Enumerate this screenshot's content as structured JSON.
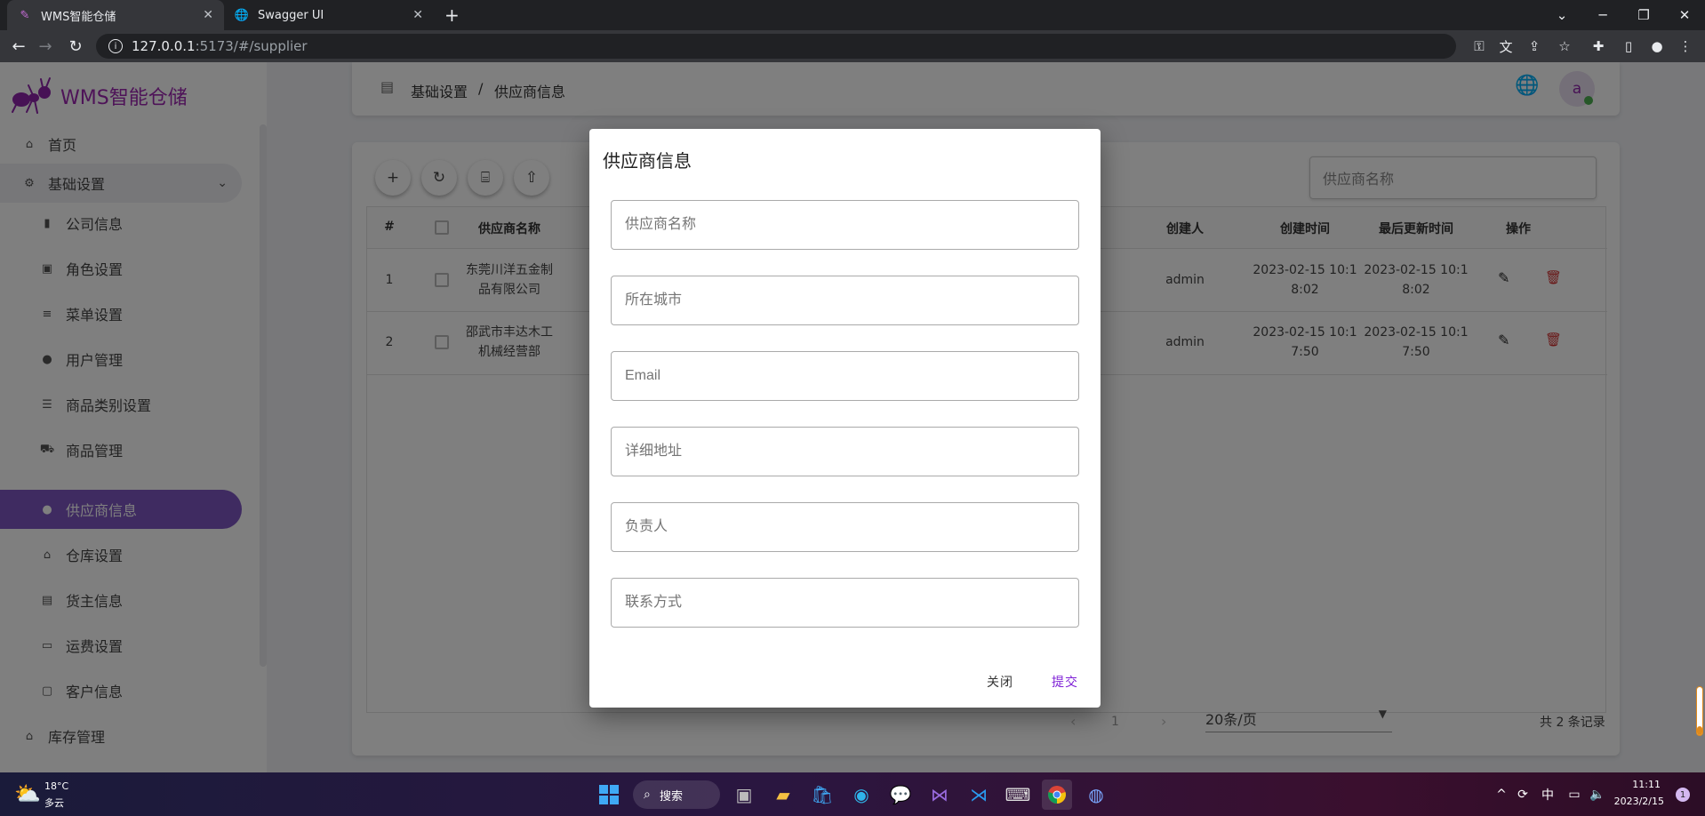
{
  "browser": {
    "tabs": [
      {
        "title": "WMS智能仓储",
        "active": true
      },
      {
        "title": "Swagger UI",
        "active": false
      }
    ],
    "new_tab": "+",
    "url_host": "127.0.0.1",
    "url_path": ":5173/#/supplier"
  },
  "app": {
    "logo_text": "WMS智能仓储",
    "breadcrumb": {
      "parent": "基础设置",
      "separator": "/",
      "current": "供应商信息"
    },
    "avatar_letter": "a",
    "colors": {
      "accent": "#7e57c2",
      "logo": "#9c27b0",
      "danger": "#d32f2f",
      "online": "#4caf50"
    },
    "sidebar": {
      "items": [
        {
          "label": "首页",
          "icon": "home-icon",
          "level": 0
        },
        {
          "label": "基础设置",
          "icon": "gear-icon",
          "level": 0,
          "expanded": true
        },
        {
          "label": "公司信息",
          "icon": "building-icon",
          "level": 1
        },
        {
          "label": "角色设置",
          "icon": "badge-icon",
          "level": 1
        },
        {
          "label": "菜单设置",
          "icon": "menu-icon",
          "level": 1
        },
        {
          "label": "用户管理",
          "icon": "person-icon",
          "level": 1
        },
        {
          "label": "商品类别设置",
          "icon": "list-icon",
          "level": 1
        },
        {
          "label": "商品管理",
          "icon": "cart-icon",
          "level": 1
        },
        {
          "label": "供应商信息",
          "icon": "person-icon",
          "level": 1,
          "active": true
        },
        {
          "label": "仓库设置",
          "icon": "warehouse-icon",
          "level": 1
        },
        {
          "label": "货主信息",
          "icon": "contact-icon",
          "level": 1
        },
        {
          "label": "运费设置",
          "icon": "money-icon",
          "level": 1
        },
        {
          "label": "客户信息",
          "icon": "account-box-icon",
          "level": 1
        },
        {
          "label": "库存管理",
          "icon": "warehouse-icon",
          "level": 0
        }
      ]
    },
    "toolbar": {
      "buttons": [
        "add-icon",
        "refresh-icon",
        "filter-icon",
        "export-icon"
      ]
    },
    "search": {
      "placeholder": "供应商名称"
    },
    "table": {
      "headers": {
        "index": "#",
        "name": "供应商名称",
        "creator": "创建人",
        "created": "创建时间",
        "updated": "最后更新时间",
        "actions": "操作"
      },
      "rows": [
        {
          "index": "1",
          "name1": "东莞川洋五金制",
          "name2": "品有限公司",
          "creator": "admin",
          "created1": "2023-02-15 10:1",
          "created2": "8:02",
          "updated1": "2023-02-15 10:1",
          "updated2": "8:02"
        },
        {
          "index": "2",
          "name1": "邵武市丰达木工",
          "name2": "机械经营部",
          "creator": "admin",
          "created1": "2023-02-15 10:1",
          "created2": "7:50",
          "updated1": "2023-02-15 10:1",
          "updated2": "7:50"
        }
      ]
    },
    "pagination": {
      "page": "1",
      "page_size": "20条/页",
      "total": "共 2 条记录"
    }
  },
  "dialog": {
    "title": "供应商信息",
    "fields": [
      {
        "placeholder": "供应商名称",
        "value": ""
      },
      {
        "placeholder": "所在城市",
        "value": ""
      },
      {
        "placeholder": "Email",
        "value": ""
      },
      {
        "placeholder": "详细地址",
        "value": ""
      },
      {
        "placeholder": "负责人",
        "value": ""
      },
      {
        "placeholder": "联系方式",
        "value": ""
      }
    ],
    "close_label": "关闭",
    "submit_label": "提交"
  },
  "taskbar": {
    "weather_temp": "18°C",
    "weather_desc": "多云",
    "search_label": "搜索",
    "ime": "中",
    "time": "11:11",
    "date": "2023/2/15",
    "notification_count": "1"
  }
}
